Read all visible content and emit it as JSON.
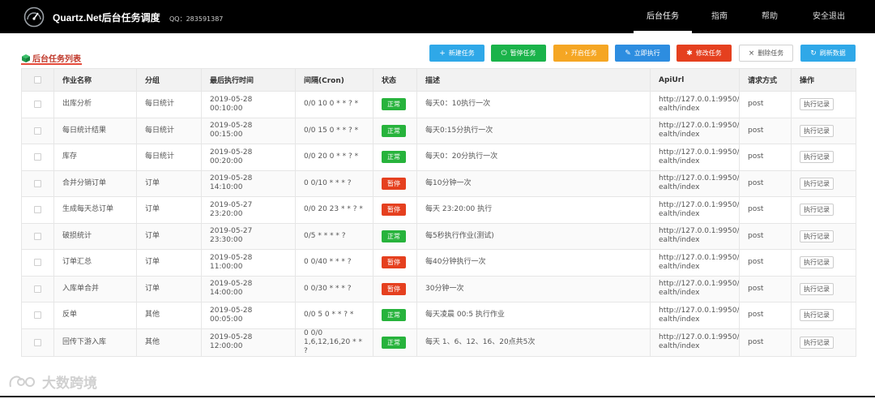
{
  "header": {
    "brand": "Quartz.Net后台任务调度",
    "qq": "QQ：283591387",
    "nav": [
      "后台任务",
      "指南",
      "帮助",
      "安全退出"
    ]
  },
  "panel": {
    "title": "后台任务列表"
  },
  "toolbar": {
    "buttons": [
      {
        "label": "新建任务",
        "icon": "+",
        "color": "#2fa8e8"
      },
      {
        "label": "暂停任务",
        "icon": "⏻",
        "color": "#1ab34a"
      },
      {
        "label": "开启任务",
        "icon": "›",
        "color": "#f5a623"
      },
      {
        "label": "立即执行",
        "icon": "✎",
        "color": "#2d8de0"
      },
      {
        "label": "修改任务",
        "icon": "✱",
        "color": "#e5401f"
      },
      {
        "label": "删除任务",
        "icon": "×",
        "color": "#ffffff"
      },
      {
        "label": "刷新数据",
        "icon": "↻",
        "color": "#2fa8e8"
      }
    ]
  },
  "table": {
    "columns": [
      "作业名称",
      "分组",
      "最后执行时间",
      "间隔(Cron)",
      "状态",
      "描述",
      "ApiUrl",
      "请求方式",
      "操作"
    ],
    "rows": [
      {
        "name": "出库分析",
        "group": "每日统计",
        "last_run": "2019-05-28 00:10:00",
        "cron": "0/0 10 0 * * ? *",
        "status": "正常",
        "status_kind": "ok",
        "desc": "每天0：10执行一次",
        "url1": "http://127.0.0.1:9950/H",
        "url2": "ealth/index",
        "method": "post",
        "action": "执行记录"
      },
      {
        "name": "每日统计结果",
        "group": "每日统计",
        "last_run": "2019-05-28 00:15:00",
        "cron": "0/0 15 0 * * ? *",
        "status": "正常",
        "status_kind": "ok",
        "desc": "每天0:15分执行一次",
        "url1": "http://127.0.0.1:9950/H",
        "url2": "ealth/index",
        "method": "post",
        "action": "执行记录"
      },
      {
        "name": "库存",
        "group": "每日统计",
        "last_run": "2019-05-28 00:20:00",
        "cron": "0/0 20 0 * * ? *",
        "status": "正常",
        "status_kind": "ok",
        "desc": "每天0：20分执行一次",
        "url1": "http://127.0.0.1:9950/H",
        "url2": "ealth/index",
        "method": "post",
        "action": "执行记录"
      },
      {
        "name": "合并分销订单",
        "group": "订单",
        "last_run": "2019-05-28 14:10:00",
        "cron": "0 0/10 * * * ?",
        "status": "暂停",
        "status_kind": "pause",
        "desc": "每10分钟一次",
        "url1": "http://127.0.0.1:9950/H",
        "url2": "ealth/index",
        "method": "post",
        "action": "执行记录"
      },
      {
        "name": "生成每天总订单",
        "group": "订单",
        "last_run": "2019-05-27 23:20:00",
        "cron": "0/0 20 23 * * ? *",
        "status": "暂停",
        "status_kind": "pause",
        "desc": "每天 23:20:00 执行",
        "url1": "http://127.0.0.1:9950/H",
        "url2": "ealth/index",
        "method": "post",
        "action": "执行记录"
      },
      {
        "name": "破损统计",
        "group": "订单",
        "last_run": "2019-05-27 23:30:00",
        "cron": "0/5 * * * * ?",
        "status": "正常",
        "status_kind": "ok",
        "desc": "每5秒执行作业(测试)",
        "url1": "http://127.0.0.1:9950/H",
        "url2": "ealth/index",
        "method": "post",
        "action": "执行记录"
      },
      {
        "name": "订单汇总",
        "group": "订单",
        "last_run": "2019-05-28 11:00:00",
        "cron": "0 0/40 * * * ?",
        "status": "暂停",
        "status_kind": "pause",
        "desc": "每40分钟执行一次",
        "url1": "http://127.0.0.1:9950/H",
        "url2": "ealth/index",
        "method": "post",
        "action": "执行记录"
      },
      {
        "name": "入库单合并",
        "group": "订单",
        "last_run": "2019-05-28 14:00:00",
        "cron": "0 0/30 * * * ?",
        "status": "暂停",
        "status_kind": "pause",
        "desc": "30分钟一次",
        "url1": "http://127.0.0.1:9950/H",
        "url2": "ealth/index",
        "method": "post",
        "action": "执行记录"
      },
      {
        "name": "反单",
        "group": "其他",
        "last_run": "2019-05-28 00:05:00",
        "cron": "0/0 5 0 * * ? *",
        "status": "正常",
        "status_kind": "ok",
        "desc": "每天凌晨 00:5 执行作业",
        "url1": "http://127.0.0.1:9950/H",
        "url2": "ealth/index",
        "method": "post",
        "action": "执行记录"
      },
      {
        "name": "回传下游入库",
        "group": "其他",
        "last_run": "2019-05-28 12:00:00",
        "cron": "0 0/0 1,6,12,16,20 * * ?",
        "status": "正常",
        "status_kind": "ok",
        "desc": "每天 1、6、12、16、20点共5次",
        "url1": "http://127.0.0.1:9950/H",
        "url2": "ealth/index",
        "method": "post",
        "action": "执行记录"
      }
    ]
  },
  "watermark": "大数跨境"
}
